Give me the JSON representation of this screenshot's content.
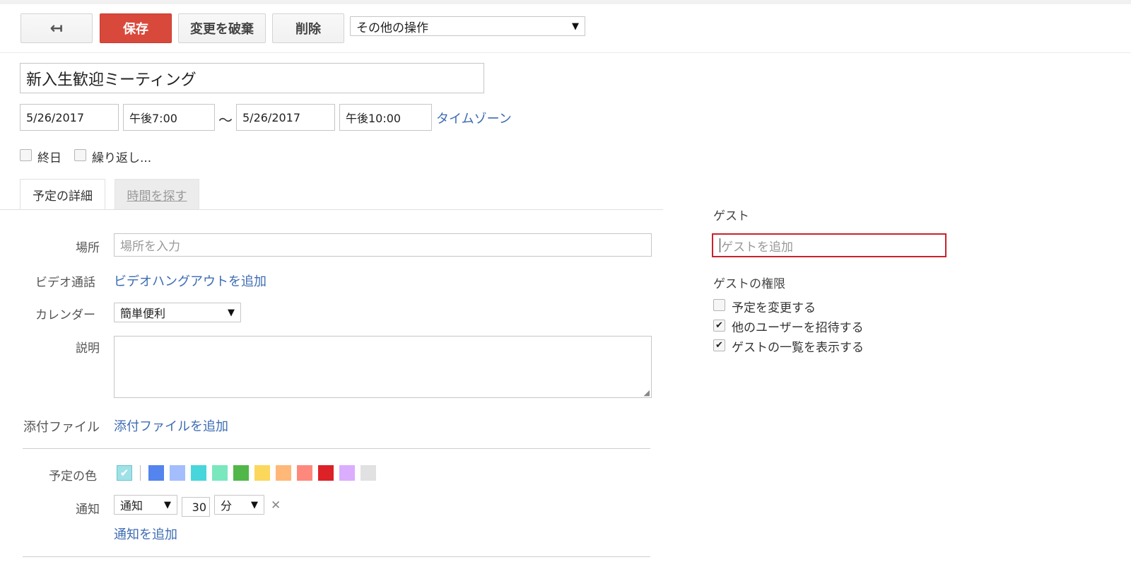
{
  "toolbar": {
    "back_icon": "↤",
    "save_label": "保存",
    "discard_label": "変更を破棄",
    "delete_label": "削除",
    "more_actions": "その他の操作"
  },
  "event": {
    "title": "新入生歓迎ミーティング",
    "start_date": "5/26/2017",
    "start_time": "午後7:00",
    "range_separator": "～",
    "end_date": "5/26/2017",
    "end_time": "午後10:00",
    "timezone_link": "タイムゾーン",
    "all_day_label": "終日",
    "repeat_label": "繰り返し..."
  },
  "tabs": [
    {
      "label": "予定の詳細"
    },
    {
      "label": "時間を探す"
    }
  ],
  "details": {
    "location_label": "場所",
    "location_placeholder": "場所を入力",
    "video_label": "ビデオ通話",
    "video_link": "ビデオハングアウトを追加",
    "calendar_label": "カレンダー",
    "calendar_value": "簡単便利",
    "description_label": "説明",
    "attachment_label": "添付ファイル",
    "attachment_link": "添付ファイルを追加",
    "color_label": "予定の色",
    "colors": [
      "#5484ed",
      "#a4bdfc",
      "#46d6db",
      "#7ae7bf",
      "#51b749",
      "#fbd75b",
      "#ffb878",
      "#ff887c",
      "#dc2127",
      "#dbadff",
      "#e1e1e1"
    ],
    "selected_color": "#9fe1e7",
    "notify_label": "通知",
    "notify_method": "通知",
    "notify_amount": "30",
    "notify_unit": "分",
    "remove_icon": "✕",
    "add_notify_link": "通知を追加"
  },
  "guests": {
    "heading": "ゲスト",
    "add_placeholder": "ゲストを追加",
    "permissions_heading": "ゲストの権限",
    "permissions": [
      {
        "label": "予定を変更する",
        "checked": false
      },
      {
        "label": "他のユーザーを招待する",
        "checked": true
      },
      {
        "label": "ゲストの一覧を表示する",
        "checked": true
      }
    ]
  }
}
